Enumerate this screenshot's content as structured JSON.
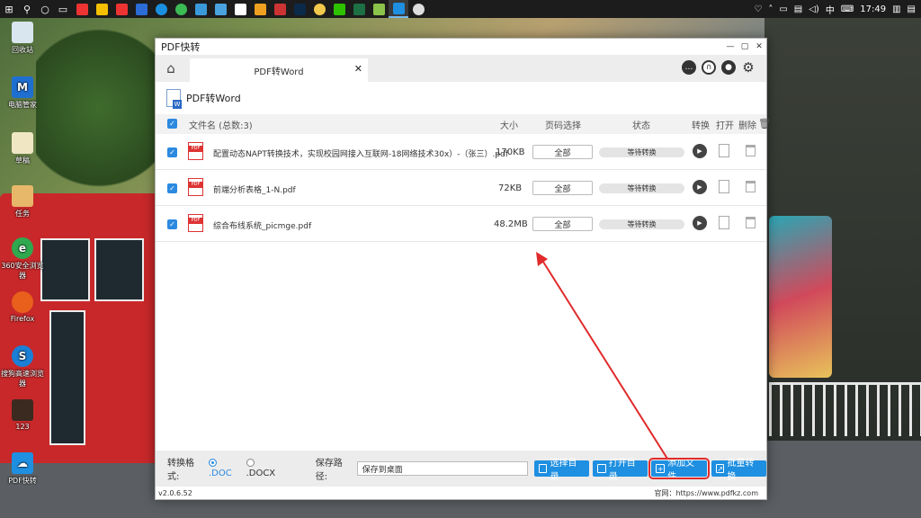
{
  "taskbar": {
    "clock": "17:49",
    "ime": "中"
  },
  "desktop": {
    "icons": [
      {
        "label": "回收站",
        "color": "#d9e5ef"
      },
      {
        "label": "电脑管家",
        "color": "#1f6fd1"
      },
      {
        "label": "草稿",
        "color": "#f0e6c4"
      },
      {
        "label": "任务",
        "color": "#e7b86a"
      },
      {
        "label": "360安全浏览器",
        "color": "#2fa84f"
      },
      {
        "label": "Firefox",
        "color": "#e8601c"
      },
      {
        "label": "搜狗高速浏览器",
        "color": "#1b7fd6"
      },
      {
        "label": "123",
        "color": "#3b2a1f"
      },
      {
        "label": "PDF快转",
        "color": "#1e8fe1"
      }
    ]
  },
  "window": {
    "title": "PDF快转",
    "tab_label": "PDF转Word",
    "section_title": "PDF转Word",
    "table_headers": {
      "filename": "文件名 (总数:3)",
      "size": "大小",
      "pages": "页码选择",
      "status": "状态",
      "convert": "转换",
      "open": "打开",
      "delete": "删除"
    },
    "files": [
      {
        "name": "配置动态NAPT转换技术，实现校园网接入互联网-18网络技术30x）-（张三）.pdf",
        "size": "170KB",
        "pages": "全部",
        "status": "等待转换"
      },
      {
        "name": "前端分析表格_1-N.pdf",
        "size": "72KB",
        "pages": "全部",
        "status": "等待转换"
      },
      {
        "name": "综合布线系统_picmge.pdf",
        "size": "48.2MB",
        "pages": "全部",
        "status": "等待转换"
      }
    ],
    "bottom": {
      "format_label": "转换格式:",
      "format_doc": ".DOC",
      "format_docx": ".DOCX",
      "save_label": "保存路径:",
      "save_value": "保存到桌面",
      "btn_choose_dir": "选择目录",
      "btn_open_dir": "打开目录",
      "btn_add_file": "添加文件",
      "btn_batch": "批量转换"
    },
    "footer": {
      "version": "v2.0.6.52",
      "site": "官网：https://www.pdfkz.com"
    }
  },
  "colors": {
    "accent": "#1e8fe1",
    "annotation": "#e02b2b"
  }
}
